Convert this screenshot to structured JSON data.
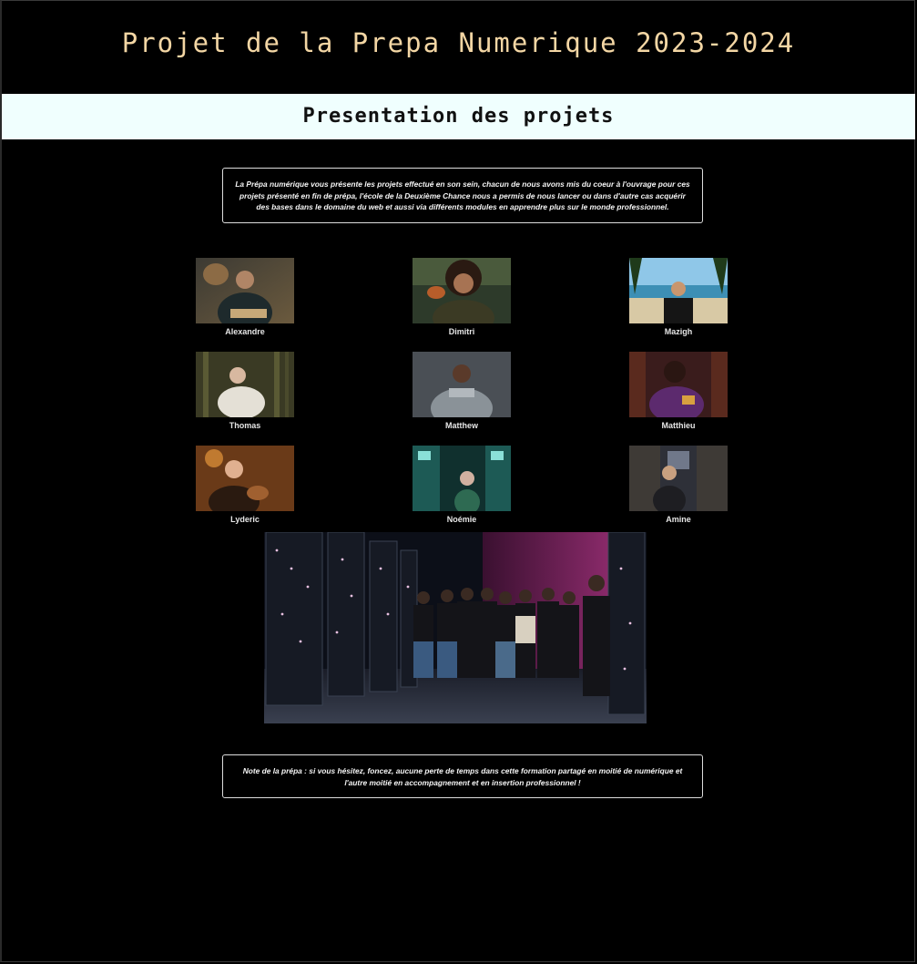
{
  "header": {
    "title": "Projet de la Prepa Numerique 2023-2024"
  },
  "section": {
    "title": "Presentation des projets"
  },
  "intro": {
    "text": "La Prépa numérique vous présente les projets effectué en son sein, chacun de nous avons mis du coeur à l'ouvrage pour ces projets présenté en fin de prépa, l'école de la Deuxième Chance nous a permis de nous lancer ou dans d'autre cas acquérir des bases dans le domaine du web et aussi via différents modules en apprendre plus sur le monde professionnel."
  },
  "members": [
    {
      "name": "Alexandre"
    },
    {
      "name": "Dimitri"
    },
    {
      "name": "Mazigh"
    },
    {
      "name": "Thomas"
    },
    {
      "name": "Matthew"
    },
    {
      "name": "Matthieu"
    },
    {
      "name": "Lyderic"
    },
    {
      "name": "Noémie"
    },
    {
      "name": "Amine"
    }
  ],
  "note": {
    "text": "Note de la prépa : si vous hésitez, foncez, aucune perte de temps dans cette formation partagé en moitié de numérique et l'autre moitié en accompagnement et en insertion professionnel !"
  },
  "colors": {
    "background": "#000000",
    "title": "#f3d6a4",
    "band": "#f0fffe",
    "text": "#f5f5f5"
  }
}
